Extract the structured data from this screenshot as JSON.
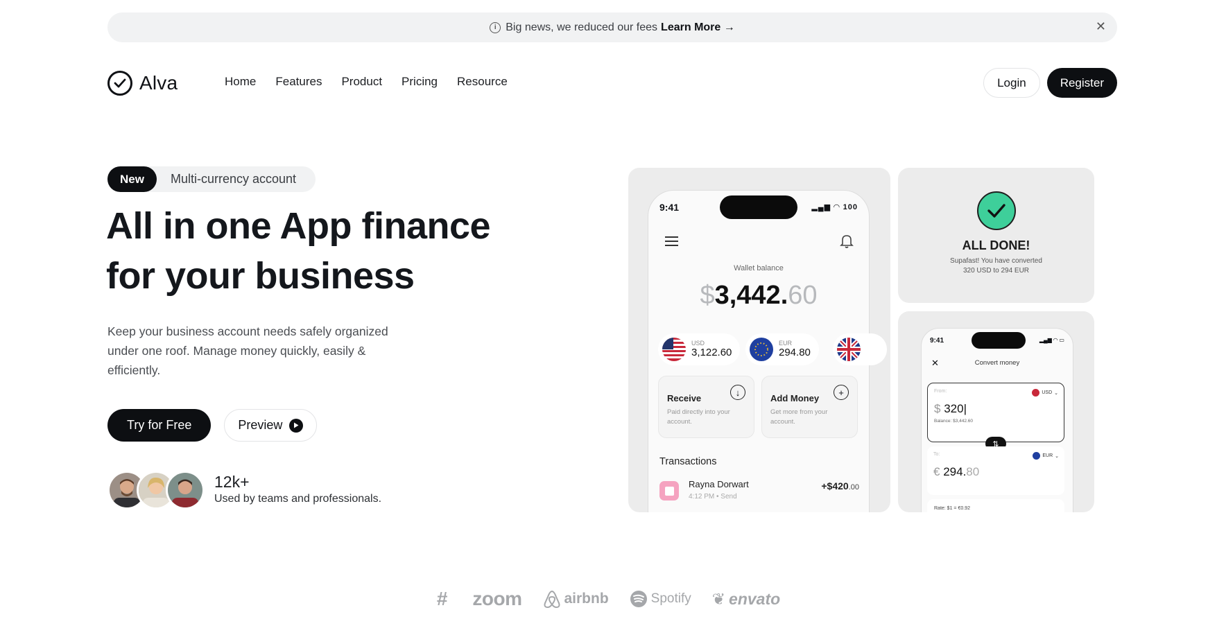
{
  "announcement": {
    "text": "Big news, we reduced our fees",
    "link": "Learn More →",
    "close_icon": "close-icon"
  },
  "header": {
    "brand": "Alva",
    "nav": [
      "Home",
      "Features",
      "Product",
      "Pricing",
      "Resource"
    ],
    "login": "Login",
    "register": "Register"
  },
  "hero": {
    "badge": "New",
    "badge_text": "Multi-currency account",
    "headline_1": "All in one App finance",
    "headline_2": "for your business",
    "description": "Keep your business account needs safely organized under one roof. Manage money quickly, easily & efficiently.",
    "cta_primary": "Try for Free",
    "cta_secondary": "Preview",
    "social_count": "12k+",
    "social_text": "Used by teams and professionals."
  },
  "wallet": {
    "time": "9:41",
    "status": "100",
    "label": "Wallet balance",
    "currency": "$",
    "whole": "3,442",
    "dot": ".",
    "cents": "60",
    "accounts": [
      {
        "code": "USD",
        "amount": "3,122.60"
      },
      {
        "code": "EUR",
        "amount": "294.80"
      }
    ],
    "receive_title": "Receive",
    "receive_desc": "Paid directly into your account.",
    "add_title": "Add Money",
    "add_desc": "Get more from your account.",
    "transactions_title": "Transactions",
    "tx_name": "Rayna Dorwart",
    "tx_meta": "4:12 PM • Send",
    "tx_amount": "+$420",
    "tx_cents": ".00"
  },
  "done": {
    "title": "ALL DONE!",
    "line1": "Supafast! You have converted",
    "line2": "320 USD to 294 EUR"
  },
  "convert": {
    "time": "9:41",
    "title": "Convert money",
    "from_label": "From:",
    "from_currency": "USD",
    "from_symbol": "$",
    "from_amount": "320",
    "balance": "Balance: $3,442.60",
    "to_label": "To:",
    "to_currency": "EUR",
    "to_symbol": "€",
    "to_whole": "294.",
    "to_cents": "80",
    "rate": "Rate:  $1 = €0.92"
  },
  "brands": [
    "zoom",
    "airbnb",
    "Spotify",
    "envato"
  ]
}
